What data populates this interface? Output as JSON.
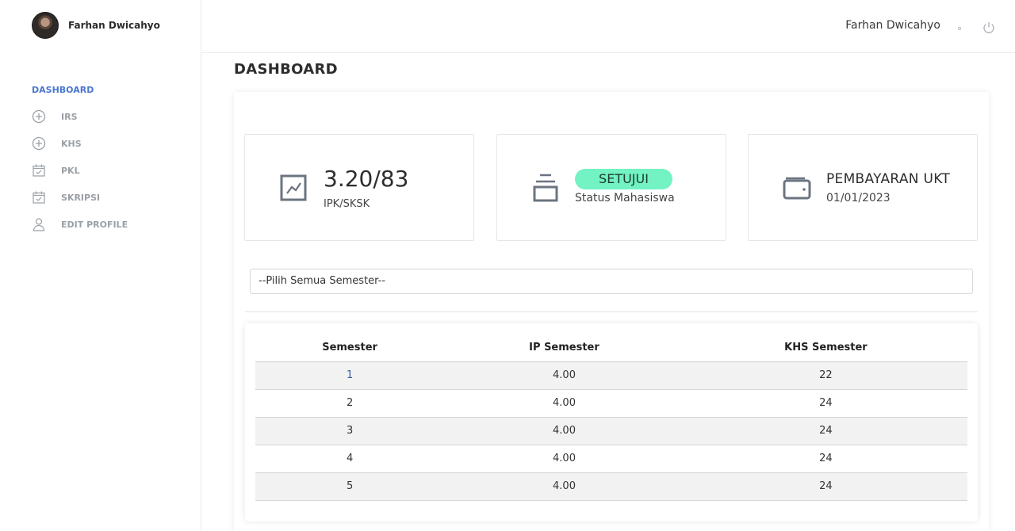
{
  "user": {
    "name": "Farhan Dwicahyo"
  },
  "sidebar": {
    "active": "DASHBOARD",
    "items": [
      {
        "label": "IRS",
        "icon": "plus-circle-icon"
      },
      {
        "label": "KHS",
        "icon": "plus-circle-icon"
      },
      {
        "label": "PKL",
        "icon": "calendar-check-icon"
      },
      {
        "label": "SKRIPSI",
        "icon": "calendar-check-icon"
      },
      {
        "label": "EDIT PROFILE",
        "icon": "user-icon"
      }
    ]
  },
  "topbar": {
    "user_name": "Farhan Dwicahyo",
    "logout_icon": "power-icon"
  },
  "page": {
    "title": "DASHBOARD"
  },
  "stats": {
    "ipk": {
      "value": "3.20/83",
      "label": "IPK/SKSK",
      "icon": "trend-chart-icon"
    },
    "status": {
      "badge": "SETUJUI",
      "label": "Status Mahasiswa",
      "icon": "archive-stack-icon",
      "badge_color": "#73f2c3"
    },
    "ukt": {
      "title": "PEMBAYARAN UKT",
      "date": "01/01/2023",
      "icon": "wallet-icon"
    }
  },
  "semester_select": {
    "value": "--Pilih Semua Semester--"
  },
  "table": {
    "headers": [
      "Semester",
      "IP Semester",
      "KHS Semester"
    ],
    "rows": [
      [
        "1",
        "4.00",
        "22"
      ],
      [
        "2",
        "4.00",
        "24"
      ],
      [
        "3",
        "4.00",
        "24"
      ],
      [
        "4",
        "4.00",
        "24"
      ],
      [
        "5",
        "4.00",
        "24"
      ]
    ]
  },
  "colors": {
    "accent": "#4a76d1",
    "muted": "#9aa0a6",
    "badge": "#73f2c3"
  }
}
